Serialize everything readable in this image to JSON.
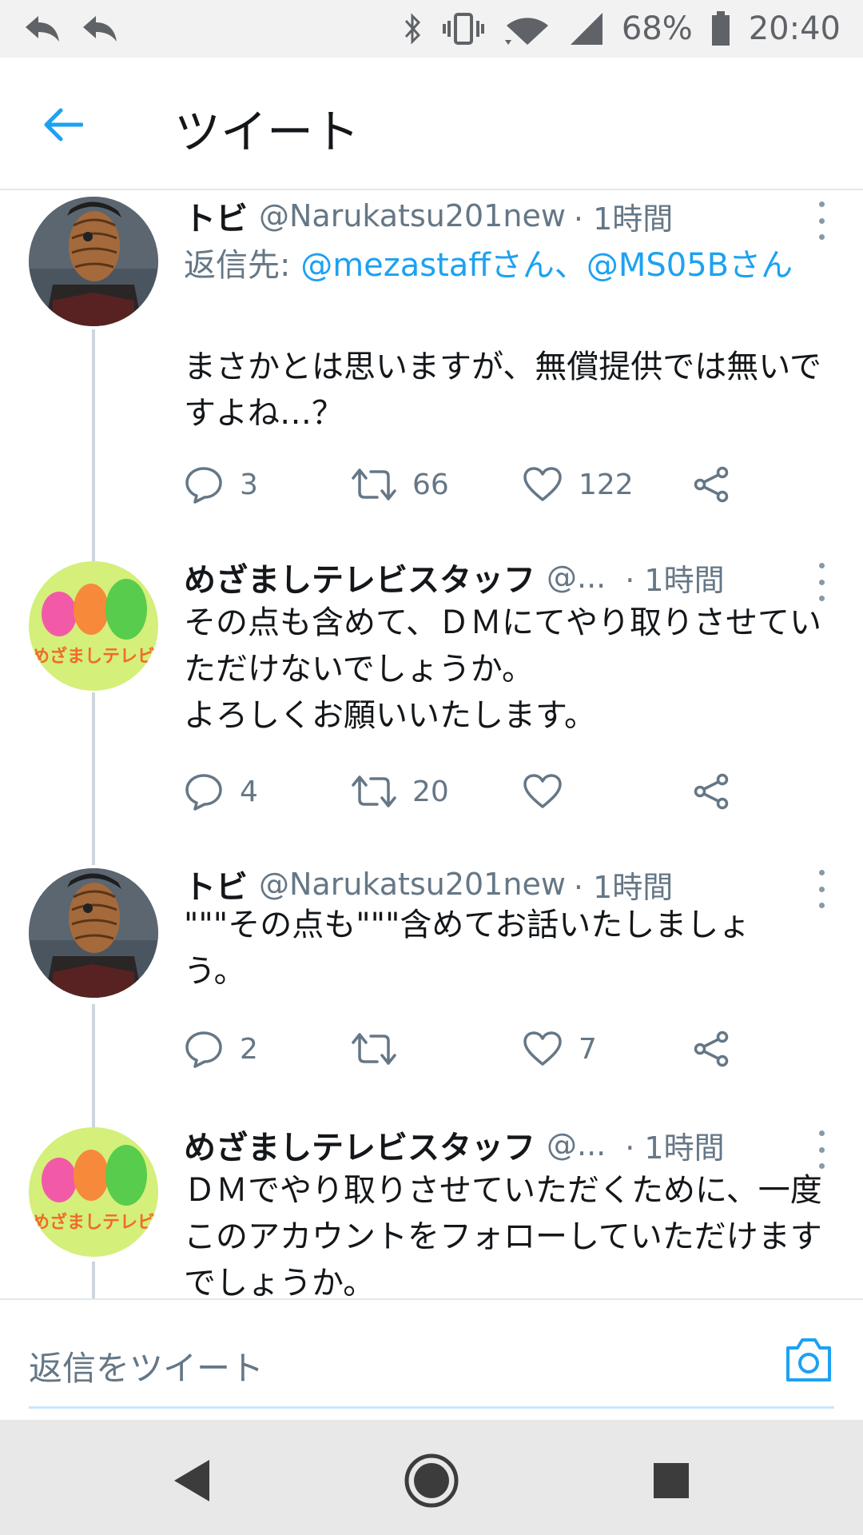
{
  "status_bar": {
    "battery": "68%",
    "time": "20:40"
  },
  "header": {
    "title": "ツイート"
  },
  "tweets": [
    {
      "name": "トビ",
      "handle": "@Narukatsu201new",
      "time": "· 1時間",
      "reply_prefix": "返信先: ",
      "reply_mentions": "@mezastaffさん、@MS05Bさん",
      "text": "まさかとは思いますが、無償提供では無いですよね…？",
      "replies": "3",
      "retweets": "66",
      "likes": "122",
      "avatar_icon": "masked-character-avatar"
    },
    {
      "name": "めざましテレビスタッフ",
      "handle": "@...",
      "time": "· 1時間",
      "text": "その点も含めて、ＤＭにてやり取りさせていただけないでしょうか。\nよろしくお願いいたします。",
      "replies": "4",
      "retweets": "20",
      "likes": "",
      "avatar_text": "めざましテレビ",
      "avatar_icon": "mezamashi-tv-logo"
    },
    {
      "name": "トビ",
      "handle": "@Narukatsu201new",
      "time": "· 1時間",
      "text": "\"\"\"その点も\"\"\"含めてお話いたしましょう。",
      "replies": "2",
      "retweets": "",
      "likes": "7",
      "avatar_icon": "masked-character-avatar"
    },
    {
      "name": "めざましテレビスタッフ",
      "handle": "@...",
      "time": "· 1時間",
      "text": "ＤＭでやり取りさせていただくために、一度このアカウントをフォローしていただけますでしょうか。",
      "avatar_text": "めざましテレビ",
      "avatar_icon": "mezamashi-tv-logo"
    }
  ],
  "reply_bar": {
    "placeholder": "返信をツイート"
  },
  "colors": {
    "accent": "#1da1f2",
    "text": "#14171a",
    "muted": "#657786"
  }
}
